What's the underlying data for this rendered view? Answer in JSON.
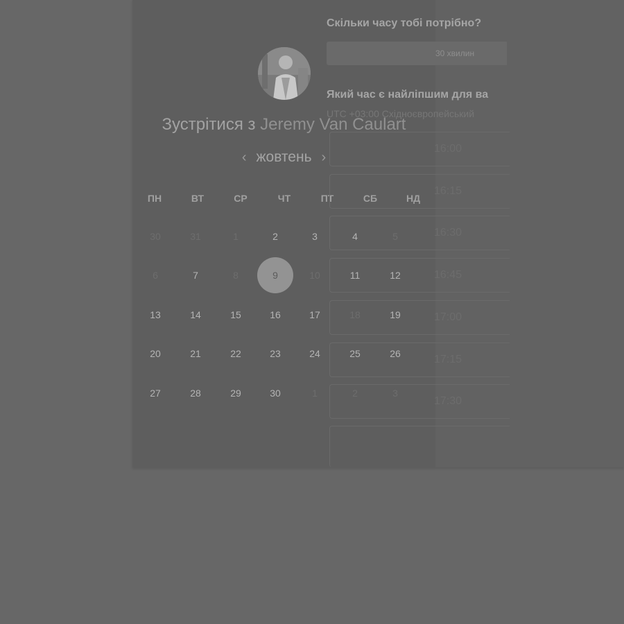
{
  "meeting": {
    "title_prefix": "Зустрітися з",
    "host_name": "Jeremy Van Caulart"
  },
  "calendar": {
    "month": "жовтень",
    "prev_icon": "chevron-left-icon",
    "next_icon": "chevron-right-icon",
    "weekdays": [
      "ПН",
      "ВТ",
      "СР",
      "ЧТ",
      "ПТ",
      "СБ",
      "НД"
    ],
    "weeks": [
      [
        {
          "d": "30",
          "s": "off"
        },
        {
          "d": "31",
          "s": "off"
        },
        {
          "d": "1",
          "s": "off"
        },
        {
          "d": "2",
          "s": "avail"
        },
        {
          "d": "3",
          "s": "avail"
        },
        {
          "d": "4",
          "s": "avail"
        },
        {
          "d": "5",
          "s": "off"
        }
      ],
      [
        {
          "d": "6",
          "s": "off"
        },
        {
          "d": "7",
          "s": "avail"
        },
        {
          "d": "8",
          "s": "off"
        },
        {
          "d": "9",
          "s": "selected"
        },
        {
          "d": "10",
          "s": "off"
        },
        {
          "d": "11",
          "s": "avail"
        },
        {
          "d": "12",
          "s": "avail"
        }
      ],
      [
        {
          "d": "13",
          "s": "avail"
        },
        {
          "d": "14",
          "s": "avail"
        },
        {
          "d": "15",
          "s": "avail"
        },
        {
          "d": "16",
          "s": "avail"
        },
        {
          "d": "17",
          "s": "avail"
        },
        {
          "d": "18",
          "s": "off"
        },
        {
          "d": "19",
          "s": "avail"
        }
      ],
      [
        {
          "d": "20",
          "s": "avail"
        },
        {
          "d": "21",
          "s": "avail"
        },
        {
          "d": "22",
          "s": "avail"
        },
        {
          "d": "23",
          "s": "avail"
        },
        {
          "d": "24",
          "s": "avail"
        },
        {
          "d": "25",
          "s": "avail"
        },
        {
          "d": "26",
          "s": "avail"
        }
      ],
      [
        {
          "d": "27",
          "s": "avail"
        },
        {
          "d": "28",
          "s": "avail"
        },
        {
          "d": "29",
          "s": "avail"
        },
        {
          "d": "30",
          "s": "avail"
        },
        {
          "d": "1",
          "s": "off"
        },
        {
          "d": "2",
          "s": "off"
        },
        {
          "d": "3",
          "s": "off"
        }
      ]
    ]
  },
  "booking": {
    "duration_question": "Скільки часу тобі потрібно?",
    "duration_value": "30 хвилин",
    "time_question": "Який час є найліпшим для ва",
    "timezone": "UTC +03:00 Східноєвропейський",
    "slots": [
      "16:00",
      "16:15",
      "16:30",
      "16:45",
      "17:00",
      "17:15",
      "17:30"
    ]
  },
  "colors": {
    "overlay": "#676767",
    "card": "#5e5e5e",
    "selected_day": "#939393"
  }
}
